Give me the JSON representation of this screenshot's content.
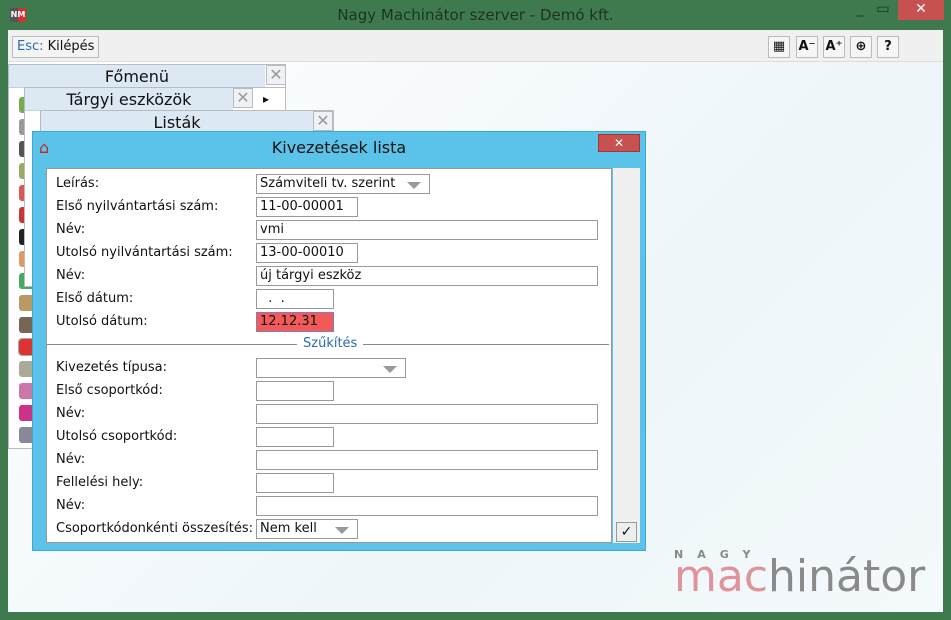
{
  "window": {
    "title": "Nagy Machinátor szerver - Demó kft.",
    "logo": "NM",
    "minimize": "_",
    "maximize": "▭",
    "close": "✕"
  },
  "toolbar": {
    "esc_key": "Esc:",
    "esc_label": "Kilépés",
    "buttons": [
      "▦",
      "A⁻",
      "A⁺",
      "⊕",
      "?"
    ]
  },
  "panels": {
    "main": "Főmenü",
    "assets": "Tárgyi eszközök",
    "lists": "Listák",
    "close": "✕",
    "arrow": "▸"
  },
  "dialog": {
    "title": "Kivezetések lista",
    "close": "✕",
    "ok": "✓",
    "fields": [
      {
        "label": "Leírás:",
        "value": "Számviteli tv. szerint"
      },
      {
        "label": "Első nyilvántartási szám:",
        "value": "11-00-00001"
      },
      {
        "label": "Név:",
        "value": "vmi"
      },
      {
        "label": "Utolsó nyilvántartási szám:",
        "value": "13-00-00010"
      },
      {
        "label": "Név:",
        "value": "új tárgyi eszköz"
      },
      {
        "label": "Első dátum:",
        "value": "  .  ."
      },
      {
        "label": "Utolsó dátum:",
        "value": "12.12.31"
      }
    ],
    "section": "Szűkítés",
    "filters": [
      {
        "label": "Kivezetés típusa:",
        "value": ""
      },
      {
        "label": "Első csoportkód:",
        "value": ""
      },
      {
        "label": "Név:",
        "value": ""
      },
      {
        "label": "Utolsó csoportkód:",
        "value": ""
      },
      {
        "label": "Név:",
        "value": ""
      },
      {
        "label": "Fellelési hely:",
        "value": ""
      },
      {
        "label": "Név:",
        "value": ""
      },
      {
        "label": "Csoportkódonkénti összesítés:",
        "value": "Nem kell"
      }
    ]
  },
  "logo": {
    "top": "NAGY",
    "part1": "mac",
    "part2": "hinátor"
  }
}
